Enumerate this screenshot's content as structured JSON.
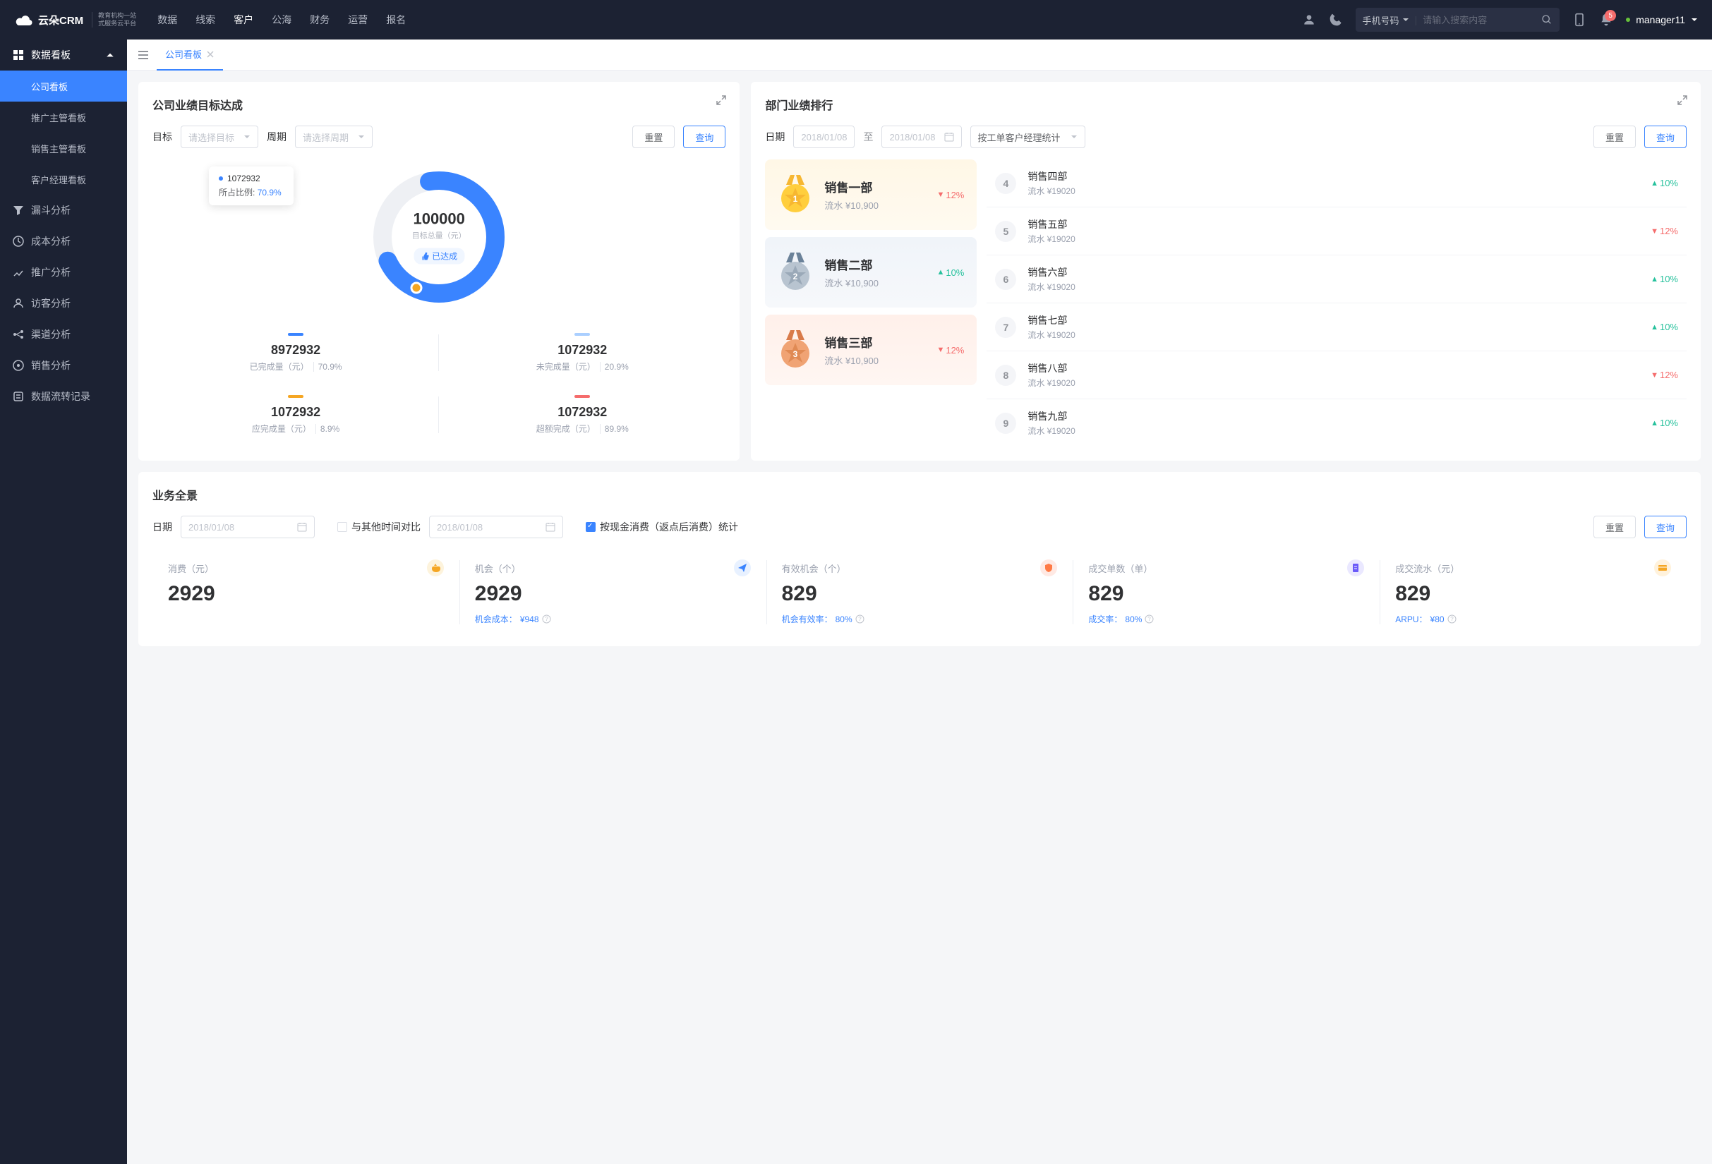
{
  "colors": {
    "accent": "#3a84ff",
    "green": "#26c19c",
    "red": "#f56c6c",
    "orange": "#f5a623"
  },
  "header": {
    "logo_text": "云朵CRM",
    "logo_sub1": "教育机构一站",
    "logo_sub2": "式服务云平台",
    "nav": [
      "数据",
      "线索",
      "客户",
      "公海",
      "财务",
      "运营",
      "报名"
    ],
    "active_nav": "客户",
    "search_type": "手机号码",
    "search_placeholder": "请输入搜索内容",
    "notif_count": "5",
    "user": "manager11"
  },
  "sidebar": {
    "sections": [
      {
        "icon": "dashboard",
        "label": "数据看板",
        "expanded": true,
        "children": [
          "公司看板",
          "推广主管看板",
          "销售主管看板",
          "客户经理看板"
        ],
        "active_child": "公司看板"
      },
      {
        "icon": "funnel",
        "label": "漏斗分析"
      },
      {
        "icon": "cost",
        "label": "成本分析"
      },
      {
        "icon": "promo",
        "label": "推广分析"
      },
      {
        "icon": "visitor",
        "label": "访客分析"
      },
      {
        "icon": "channel",
        "label": "渠道分析"
      },
      {
        "icon": "sales",
        "label": "销售分析"
      },
      {
        "icon": "flow",
        "label": "数据流转记录"
      }
    ]
  },
  "tab": {
    "label": "公司看板"
  },
  "target_card": {
    "title": "公司业绩目标达成",
    "filters": {
      "target_label": "目标",
      "target_placeholder": "请选择目标",
      "period_label": "周期",
      "period_placeholder": "请选择周期",
      "reset": "重置",
      "query": "查询"
    },
    "donut": {
      "total": "100000",
      "total_label": "目标总量（元）",
      "badge": "已达成",
      "tooltip_value": "1072932",
      "tooltip_ratio_label": "所占比例:",
      "tooltip_ratio": "70.9%"
    },
    "stats": [
      {
        "color": "#3a84ff",
        "value": "8972932",
        "label": "已完成量（元）",
        "pct": "70.9%"
      },
      {
        "color": "#aacfff",
        "value": "1072932",
        "label": "未完成量（元）",
        "pct": "20.9%"
      },
      {
        "color": "#f5a623",
        "value": "1072932",
        "label": "应完成量（元）",
        "pct": "8.9%"
      },
      {
        "color": "#f56c6c",
        "value": "1072932",
        "label": "超额完成（元）",
        "pct": "89.9%"
      }
    ]
  },
  "rank_card": {
    "title": "部门业绩排行",
    "filters": {
      "date_label": "日期",
      "date_from": "2018/01/08",
      "date_to_label": "至",
      "date_to": "2018/01/08",
      "stat_by": "按工单客户经理统计",
      "reset": "重置",
      "query": "查询"
    },
    "podium": [
      {
        "rank": 1,
        "name": "销售一部",
        "value_label": "流水",
        "value": "¥10,900",
        "trend": "down",
        "pct": "12%"
      },
      {
        "rank": 2,
        "name": "销售二部",
        "value_label": "流水",
        "value": "¥10,900",
        "trend": "up",
        "pct": "10%"
      },
      {
        "rank": 3,
        "name": "销售三部",
        "value_label": "流水",
        "value": "¥10,900",
        "trend": "down",
        "pct": "12%"
      }
    ],
    "list": [
      {
        "rank": 4,
        "name": "销售四部",
        "value": "流水 ¥19020",
        "trend": "up",
        "pct": "10%"
      },
      {
        "rank": 5,
        "name": "销售五部",
        "value": "流水 ¥19020",
        "trend": "down",
        "pct": "12%"
      },
      {
        "rank": 6,
        "name": "销售六部",
        "value": "流水 ¥19020",
        "trend": "up",
        "pct": "10%"
      },
      {
        "rank": 7,
        "name": "销售七部",
        "value": "流水 ¥19020",
        "trend": "up",
        "pct": "10%"
      },
      {
        "rank": 8,
        "name": "销售八部",
        "value": "流水 ¥19020",
        "trend": "down",
        "pct": "12%"
      },
      {
        "rank": 9,
        "name": "销售九部",
        "value": "流水 ¥19020",
        "trend": "up",
        "pct": "10%"
      }
    ]
  },
  "overview_card": {
    "title": "业务全景",
    "filters": {
      "date_label": "日期",
      "date1": "2018/01/08",
      "compare_label": "与其他时间对比",
      "date2": "2018/01/08",
      "cash_label": "按现金消费（返点后消费）统计",
      "reset": "重置",
      "query": "查询"
    },
    "kpis": [
      {
        "icon": "money",
        "icon_bg": "#fdf3dc",
        "icon_color": "#f5a623",
        "label": "消费（元）",
        "value": "2929",
        "sub": ""
      },
      {
        "icon": "send",
        "icon_bg": "#e8f1ff",
        "icon_color": "#3a84ff",
        "label": "机会（个）",
        "value": "2929",
        "sub_label": "机会成本：",
        "sub_value": "¥948"
      },
      {
        "icon": "shield",
        "icon_bg": "#ffe9e3",
        "icon_color": "#ff7a45",
        "label": "有效机会（个）",
        "value": "829",
        "sub_label": "机会有效率：",
        "sub_value": "80%"
      },
      {
        "icon": "doc",
        "icon_bg": "#eae8ff",
        "icon_color": "#6a5af9",
        "label": "成交单数（单）",
        "value": "829",
        "sub_label": "成交率：",
        "sub_value": "80%"
      },
      {
        "icon": "card",
        "icon_bg": "#fff2dc",
        "icon_color": "#f5a623",
        "label": "成交流水（元）",
        "value": "829",
        "sub_label": "ARPU：",
        "sub_value": "¥80"
      }
    ]
  },
  "chart_data": {
    "type": "pie",
    "title": "公司业绩目标达成",
    "total": 100000,
    "total_label": "目标总量（元）",
    "series": [
      {
        "name": "已完成量（元）",
        "value": 8972932,
        "pct": 70.9,
        "color": "#3a84ff"
      },
      {
        "name": "未完成量（元）",
        "value": 1072932,
        "pct": 20.9,
        "color": "#aacfff"
      },
      {
        "name": "应完成量（元）",
        "value": 1072932,
        "pct": 8.9,
        "color": "#f5a623"
      },
      {
        "name": "超额完成（元）",
        "value": 1072932,
        "pct": 89.9,
        "color": "#f56c6c"
      }
    ]
  }
}
